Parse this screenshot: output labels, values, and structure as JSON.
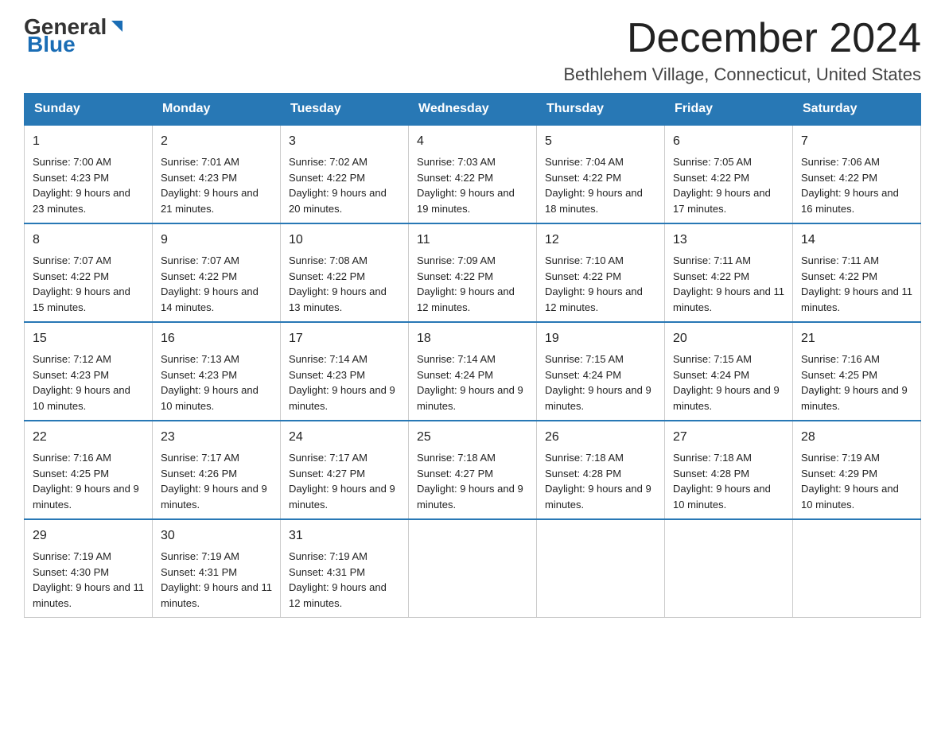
{
  "header": {
    "logo_general": "General",
    "logo_blue": "Blue",
    "month_title": "December 2024",
    "location": "Bethlehem Village, Connecticut, United States"
  },
  "weekdays": [
    "Sunday",
    "Monday",
    "Tuesday",
    "Wednesday",
    "Thursday",
    "Friday",
    "Saturday"
  ],
  "weeks": [
    [
      {
        "day": "1",
        "sunrise": "7:00 AM",
        "sunset": "4:23 PM",
        "daylight": "9 hours and 23 minutes."
      },
      {
        "day": "2",
        "sunrise": "7:01 AM",
        "sunset": "4:23 PM",
        "daylight": "9 hours and 21 minutes."
      },
      {
        "day": "3",
        "sunrise": "7:02 AM",
        "sunset": "4:22 PM",
        "daylight": "9 hours and 20 minutes."
      },
      {
        "day": "4",
        "sunrise": "7:03 AM",
        "sunset": "4:22 PM",
        "daylight": "9 hours and 19 minutes."
      },
      {
        "day": "5",
        "sunrise": "7:04 AM",
        "sunset": "4:22 PM",
        "daylight": "9 hours and 18 minutes."
      },
      {
        "day": "6",
        "sunrise": "7:05 AM",
        "sunset": "4:22 PM",
        "daylight": "9 hours and 17 minutes."
      },
      {
        "day": "7",
        "sunrise": "7:06 AM",
        "sunset": "4:22 PM",
        "daylight": "9 hours and 16 minutes."
      }
    ],
    [
      {
        "day": "8",
        "sunrise": "7:07 AM",
        "sunset": "4:22 PM",
        "daylight": "9 hours and 15 minutes."
      },
      {
        "day": "9",
        "sunrise": "7:07 AM",
        "sunset": "4:22 PM",
        "daylight": "9 hours and 14 minutes."
      },
      {
        "day": "10",
        "sunrise": "7:08 AM",
        "sunset": "4:22 PM",
        "daylight": "9 hours and 13 minutes."
      },
      {
        "day": "11",
        "sunrise": "7:09 AM",
        "sunset": "4:22 PM",
        "daylight": "9 hours and 12 minutes."
      },
      {
        "day": "12",
        "sunrise": "7:10 AM",
        "sunset": "4:22 PM",
        "daylight": "9 hours and 12 minutes."
      },
      {
        "day": "13",
        "sunrise": "7:11 AM",
        "sunset": "4:22 PM",
        "daylight": "9 hours and 11 minutes."
      },
      {
        "day": "14",
        "sunrise": "7:11 AM",
        "sunset": "4:22 PM",
        "daylight": "9 hours and 11 minutes."
      }
    ],
    [
      {
        "day": "15",
        "sunrise": "7:12 AM",
        "sunset": "4:23 PM",
        "daylight": "9 hours and 10 minutes."
      },
      {
        "day": "16",
        "sunrise": "7:13 AM",
        "sunset": "4:23 PM",
        "daylight": "9 hours and 10 minutes."
      },
      {
        "day": "17",
        "sunrise": "7:14 AM",
        "sunset": "4:23 PM",
        "daylight": "9 hours and 9 minutes."
      },
      {
        "day": "18",
        "sunrise": "7:14 AM",
        "sunset": "4:24 PM",
        "daylight": "9 hours and 9 minutes."
      },
      {
        "day": "19",
        "sunrise": "7:15 AM",
        "sunset": "4:24 PM",
        "daylight": "9 hours and 9 minutes."
      },
      {
        "day": "20",
        "sunrise": "7:15 AM",
        "sunset": "4:24 PM",
        "daylight": "9 hours and 9 minutes."
      },
      {
        "day": "21",
        "sunrise": "7:16 AM",
        "sunset": "4:25 PM",
        "daylight": "9 hours and 9 minutes."
      }
    ],
    [
      {
        "day": "22",
        "sunrise": "7:16 AM",
        "sunset": "4:25 PM",
        "daylight": "9 hours and 9 minutes."
      },
      {
        "day": "23",
        "sunrise": "7:17 AM",
        "sunset": "4:26 PM",
        "daylight": "9 hours and 9 minutes."
      },
      {
        "day": "24",
        "sunrise": "7:17 AM",
        "sunset": "4:27 PM",
        "daylight": "9 hours and 9 minutes."
      },
      {
        "day": "25",
        "sunrise": "7:18 AM",
        "sunset": "4:27 PM",
        "daylight": "9 hours and 9 minutes."
      },
      {
        "day": "26",
        "sunrise": "7:18 AM",
        "sunset": "4:28 PM",
        "daylight": "9 hours and 9 minutes."
      },
      {
        "day": "27",
        "sunrise": "7:18 AM",
        "sunset": "4:28 PM",
        "daylight": "9 hours and 10 minutes."
      },
      {
        "day": "28",
        "sunrise": "7:19 AM",
        "sunset": "4:29 PM",
        "daylight": "9 hours and 10 minutes."
      }
    ],
    [
      {
        "day": "29",
        "sunrise": "7:19 AM",
        "sunset": "4:30 PM",
        "daylight": "9 hours and 11 minutes."
      },
      {
        "day": "30",
        "sunrise": "7:19 AM",
        "sunset": "4:31 PM",
        "daylight": "9 hours and 11 minutes."
      },
      {
        "day": "31",
        "sunrise": "7:19 AM",
        "sunset": "4:31 PM",
        "daylight": "9 hours and 12 minutes."
      },
      null,
      null,
      null,
      null
    ]
  ]
}
